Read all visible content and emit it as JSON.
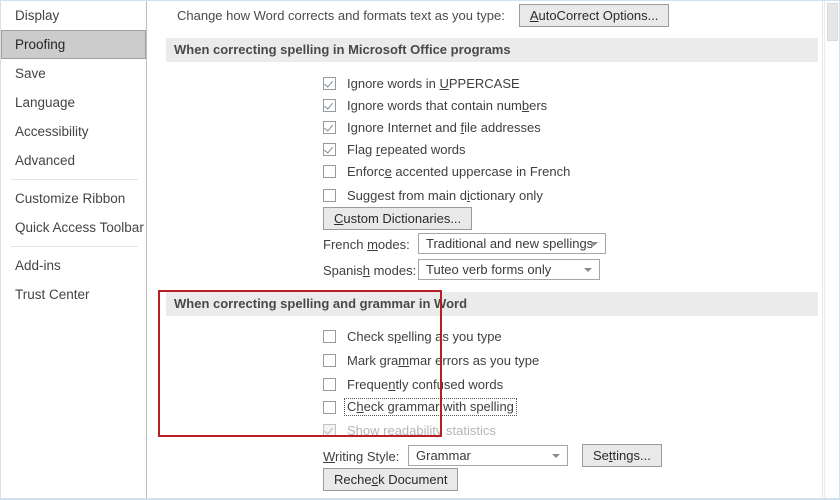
{
  "sidebar": {
    "items": [
      {
        "label": "Display",
        "selected": false,
        "sep_after": false
      },
      {
        "label": "Proofing",
        "selected": true,
        "sep_after": false
      },
      {
        "label": "Save",
        "selected": false,
        "sep_after": false
      },
      {
        "label": "Language",
        "selected": false,
        "sep_after": false
      },
      {
        "label": "Accessibility",
        "selected": false,
        "sep_after": false
      },
      {
        "label": "Advanced",
        "selected": false,
        "sep_after": true
      },
      {
        "label": "Customize Ribbon",
        "selected": false,
        "sep_after": false
      },
      {
        "label": "Quick Access Toolbar",
        "selected": false,
        "sep_after": true
      },
      {
        "label": "Add-ins",
        "selected": false,
        "sep_after": false
      },
      {
        "label": "Trust Center",
        "selected": false,
        "sep_after": false
      }
    ]
  },
  "main": {
    "intro_text": "Change how Word corrects and formats text as you type:",
    "autocorrect_button": "AutoCorrect Options...",
    "section_office": {
      "title": "When correcting spelling in Microsoft Office programs",
      "checkboxes": [
        {
          "label": "Ignore words in UPPERCASE",
          "checked": true,
          "disabled": false,
          "focused": false
        },
        {
          "label": "Ignore words that contain numbers",
          "checked": true,
          "disabled": false,
          "focused": false
        },
        {
          "label": "Ignore Internet and file addresses",
          "checked": true,
          "disabled": false,
          "focused": false
        },
        {
          "label": "Flag repeated words",
          "checked": true,
          "disabled": false,
          "focused": false
        },
        {
          "label": "Enforce accented uppercase in French",
          "checked": false,
          "disabled": false,
          "focused": false
        },
        {
          "label": "Suggest from main dictionary only",
          "checked": false,
          "disabled": false,
          "focused": false
        }
      ],
      "custom_dictionaries_button": "Custom Dictionaries...",
      "french_modes_label": "French modes:",
      "french_modes_value": "Traditional and new spellings",
      "spanish_modes_label": "Spanish modes:",
      "spanish_modes_value": "Tuteo verb forms only"
    },
    "section_word": {
      "title": "When correcting spelling and grammar in Word",
      "checkboxes": [
        {
          "label": "Check spelling as you type",
          "checked": false,
          "disabled": false,
          "focused": false
        },
        {
          "label": "Mark grammar errors as you type",
          "checked": false,
          "disabled": false,
          "focused": false
        },
        {
          "label": "Frequently confused words",
          "checked": false,
          "disabled": false,
          "focused": false
        },
        {
          "label": "Check grammar with spelling",
          "checked": false,
          "disabled": false,
          "focused": true
        },
        {
          "label": "Show readability statistics",
          "checked": true,
          "disabled": true,
          "focused": false
        }
      ],
      "writing_style_label": "Writing Style:",
      "writing_style_value": "Grammar",
      "settings_button": "Settings...",
      "recheck_button": "Recheck Document"
    }
  },
  "annotation": {
    "highlight_color": "#b62025"
  }
}
